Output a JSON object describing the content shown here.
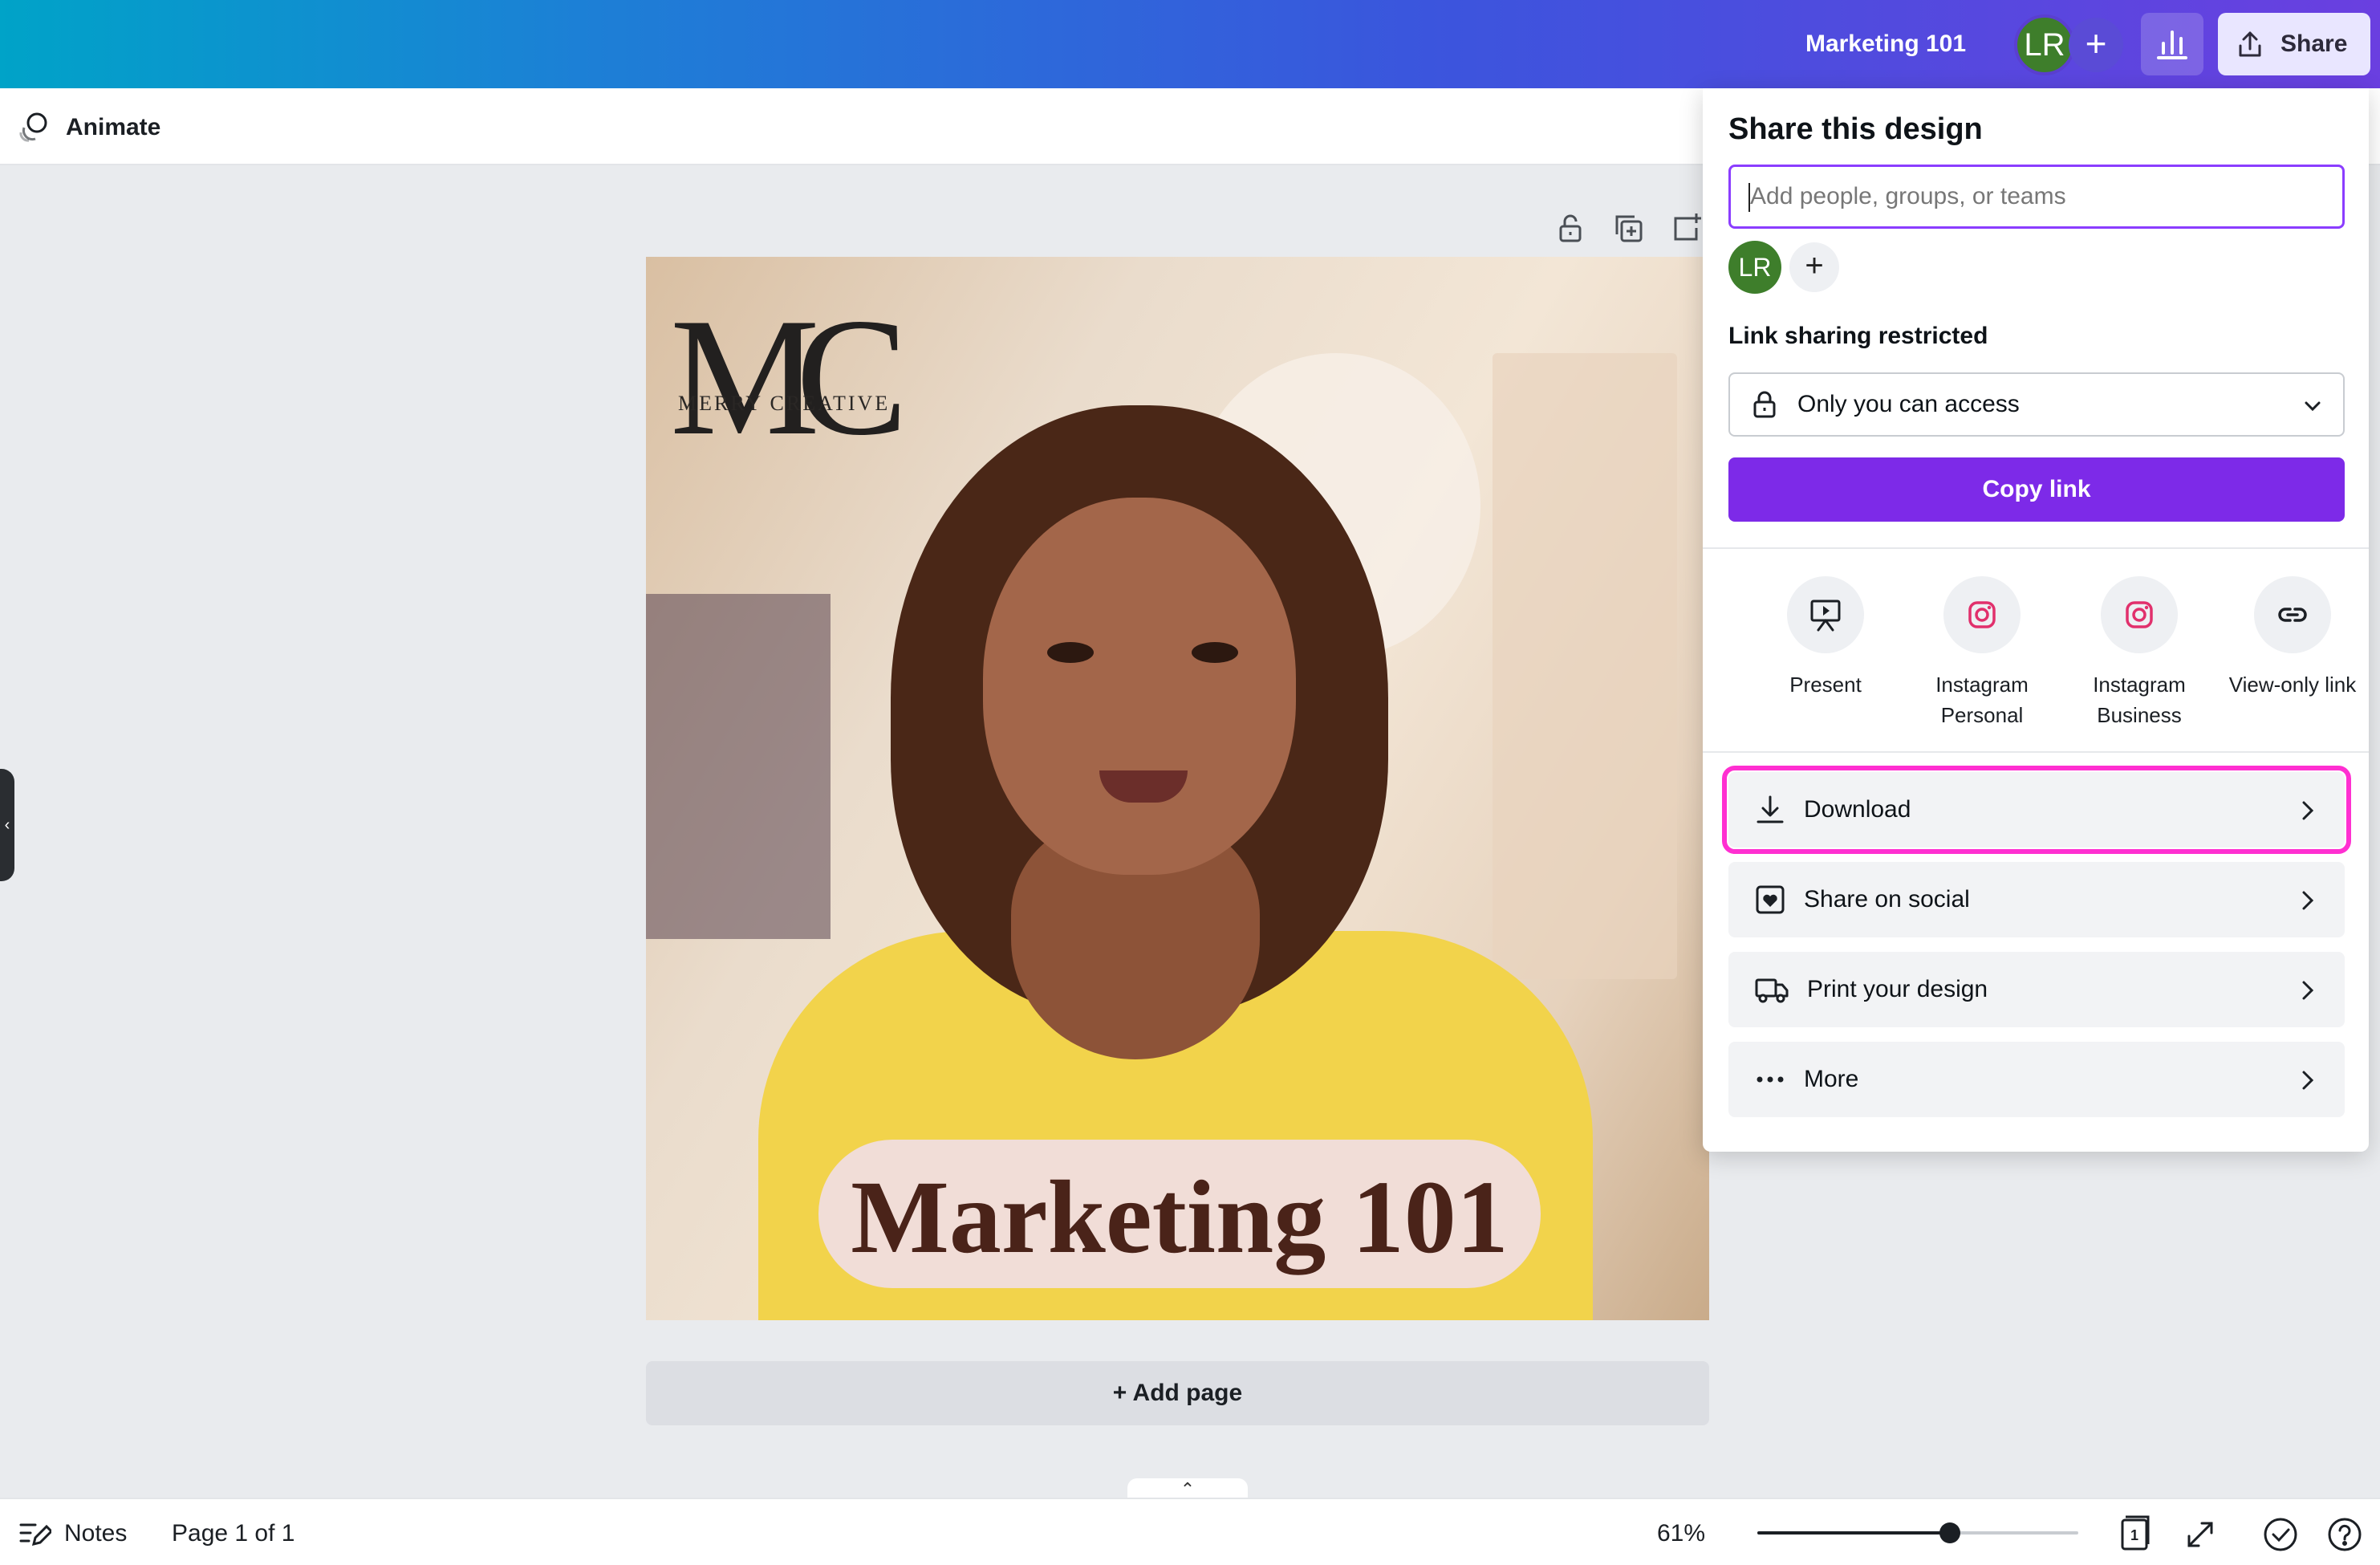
{
  "header": {
    "doc_title": "Marketing 101",
    "avatar_initials": "LR",
    "add_symbol": "+",
    "share_label": "Share"
  },
  "toolbar": {
    "animate_label": "Animate"
  },
  "design": {
    "logo_text": "MC",
    "logo_subtitle": "MERRY CREATIVE",
    "title_text": "Marketing 101"
  },
  "canvas": {
    "add_page_label": "+ Add page"
  },
  "footer": {
    "notes_label": "Notes",
    "page_count": "Page 1 of 1",
    "zoom_level": "61%",
    "zoom_fraction": 0.6,
    "page_thumb_number": "1"
  },
  "share_panel": {
    "title": "Share this design",
    "input_placeholder": "Add people, groups, or teams",
    "avatar_initials": "LR",
    "add_symbol": "+",
    "link_sharing_label": "Link sharing restricted",
    "access_value": "Only you can access",
    "copy_link_label": "Copy link",
    "share_options": [
      {
        "label": "Present",
        "icon": "present-icon"
      },
      {
        "label": "Instagram Personal",
        "icon": "instagram-icon"
      },
      {
        "label": "Instagram Business",
        "icon": "instagram-icon"
      },
      {
        "label": "View-only link",
        "icon": "link-icon"
      }
    ],
    "actions": [
      {
        "label": "Download",
        "icon": "download-icon",
        "highlighted": true
      },
      {
        "label": "Share on social",
        "icon": "heart-icon"
      },
      {
        "label": "Print your design",
        "icon": "truck-icon"
      },
      {
        "label": "More",
        "icon": "more-icon"
      }
    ],
    "accent_color": "#7d2ae8",
    "highlight_color": "#ff2fd1"
  }
}
